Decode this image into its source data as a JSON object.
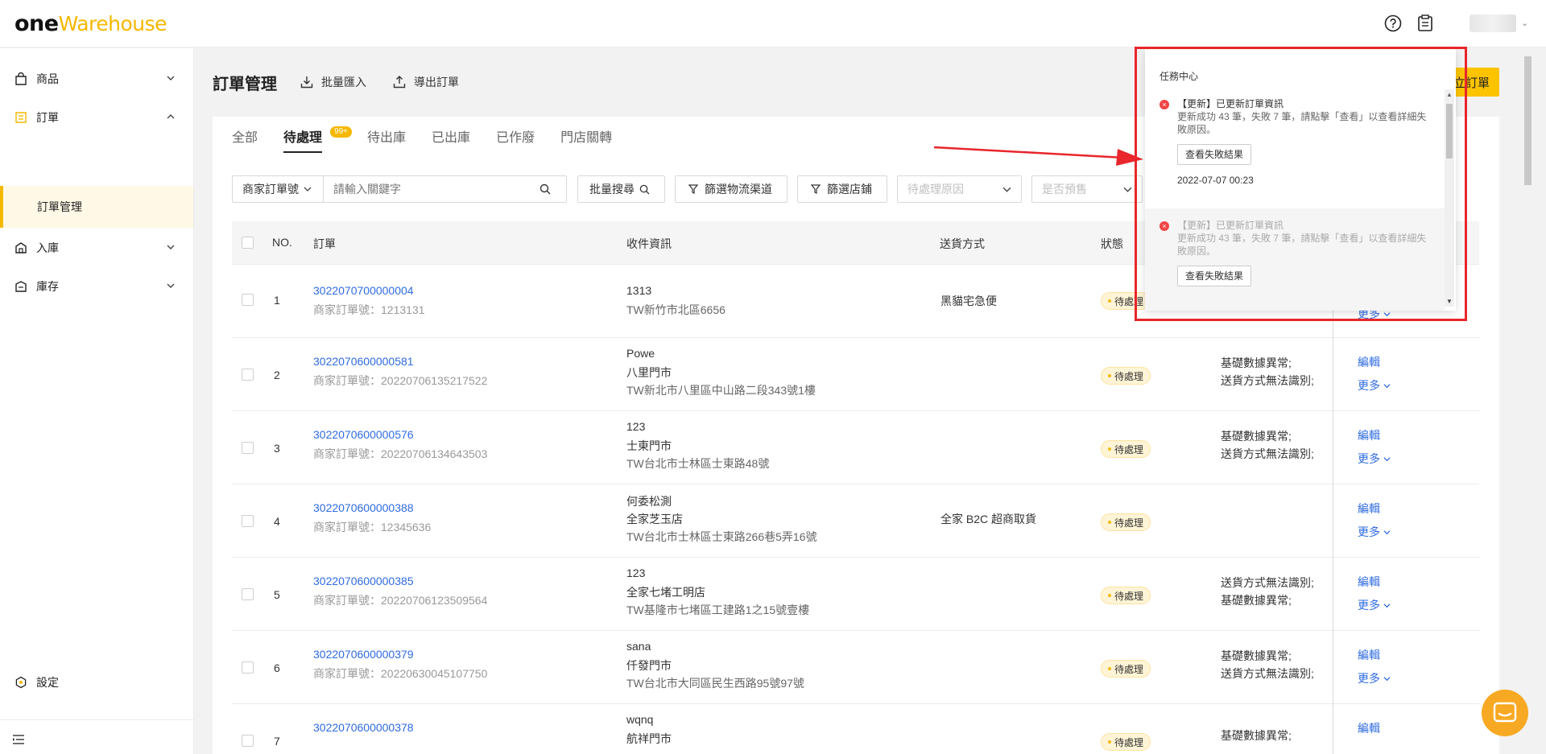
{
  "header": {
    "logo_one": "one",
    "logo_warehouse": "Warehouse"
  },
  "sidebar": {
    "items": [
      {
        "label": "商品",
        "icon": "bag-icon"
      },
      {
        "label": "訂單",
        "icon": "order-icon"
      },
      {
        "label": "入庫",
        "icon": "inbound-icon"
      },
      {
        "label": "庫存",
        "icon": "inventory-icon"
      }
    ],
    "sub_item": "訂單管理",
    "settings": "設定"
  },
  "page": {
    "title": "訂單管理",
    "bulk_import": "批量匯入",
    "export": "導出訂單",
    "create_button": "立訂單"
  },
  "tabs": [
    {
      "label": "全部"
    },
    {
      "label": "待處理",
      "badge": "99+"
    },
    {
      "label": "待出庫"
    },
    {
      "label": "已出庫"
    },
    {
      "label": "已作廢"
    },
    {
      "label": "門店關轉"
    }
  ],
  "filters": {
    "search_type": "商家訂單號",
    "keyword_placeholder": "請輸入關鍵字",
    "batch_search": "批量搜尋",
    "logistics": "篩選物流渠道",
    "store": "篩選店鋪",
    "reason_placeholder": "待處理原因",
    "presale_placeholder": "是否預售"
  },
  "table": {
    "headers": {
      "no": "NO.",
      "order": "訂單",
      "recipient": "收件資訊",
      "shipping": "送貨方式",
      "status": "狀態"
    },
    "rows": [
      {
        "no": "1",
        "order": "3022070700000004",
        "merchant": "商家訂單號：1213131",
        "recipient": [
          "1313",
          "TW新竹市北區6656"
        ],
        "shipping": "黑貓宅急便",
        "status": "待處理",
        "reasons": [],
        "edit": "",
        "more": "更多"
      },
      {
        "no": "2",
        "order": "3022070600000581",
        "merchant": "商家訂單號：20220706135217522",
        "recipient": [
          "Powe",
          "八里門市",
          "TW新北市八里區中山路二段343號1樓"
        ],
        "shipping": "",
        "status": "待處理",
        "reasons": [
          "基礎數據異常;",
          "送貨方式無法識別;"
        ],
        "edit": "編輯",
        "more": "更多"
      },
      {
        "no": "3",
        "order": "3022070600000576",
        "merchant": "商家訂單號：20220706134643503",
        "recipient": [
          "123",
          "士東門市",
          "TW台北市士林區士東路48號"
        ],
        "shipping": "",
        "status": "待處理",
        "reasons": [
          "基礎數據異常;",
          "送貨方式無法識別;"
        ],
        "edit": "編輯",
        "more": "更多"
      },
      {
        "no": "4",
        "order": "3022070600000388",
        "merchant": "商家訂單號：12345636",
        "recipient": [
          "何委松測",
          "全家芝玉店",
          "TW台北市士林區士東路266巷5弄16號"
        ],
        "shipping": "全家 B2C 超商取貨",
        "status": "待處理",
        "reasons": [],
        "edit": "編輯",
        "more": "更多"
      },
      {
        "no": "5",
        "order": "3022070600000385",
        "merchant": "商家訂單號：20220706123509564",
        "recipient": [
          "123",
          "全家七堵工明店",
          "TW基隆市七堵區工建路1之15號壹樓"
        ],
        "shipping": "",
        "status": "待處理",
        "reasons": [
          "送貨方式無法識別;",
          "基礎數據異常;"
        ],
        "edit": "編輯",
        "more": "更多"
      },
      {
        "no": "6",
        "order": "3022070600000379",
        "merchant": "商家訂單號：20220630045107750",
        "recipient": [
          "sana",
          "仟發門市",
          "TW台北市大同區民生西路95號97號"
        ],
        "shipping": "",
        "status": "待處理",
        "reasons": [
          "基礎數據異常;",
          "送貨方式無法識別;"
        ],
        "edit": "編輯",
        "more": "更多"
      },
      {
        "no": "7",
        "order": "3022070600000378",
        "merchant": "",
        "recipient": [
          "wqnq",
          "航祥門市"
        ],
        "shipping": "",
        "status": "待處理",
        "reasons": [
          "基礎數據異常;"
        ],
        "edit": "編輯",
        "more": ""
      }
    ]
  },
  "popup": {
    "title": "任務中心",
    "tasks": [
      {
        "title": "【更新】已更新訂單資訊",
        "desc": "更新成功 43 筆，失敗 7 筆，請點擊「查看」以查看詳細失敗原因。",
        "button": "查看失敗結果",
        "time": "2022-07-07 00:23"
      },
      {
        "title": "【更新】已更新訂單資訊",
        "desc": "更新成功 43 筆，失敗 7 筆，請點擊「查看」以查看詳細失敗原因。",
        "button": "查看失敗結果",
        "time": ""
      }
    ]
  },
  "colors": {
    "accent": "#f5b800",
    "link": "#2f6be0",
    "annotation": "#e8262b"
  }
}
